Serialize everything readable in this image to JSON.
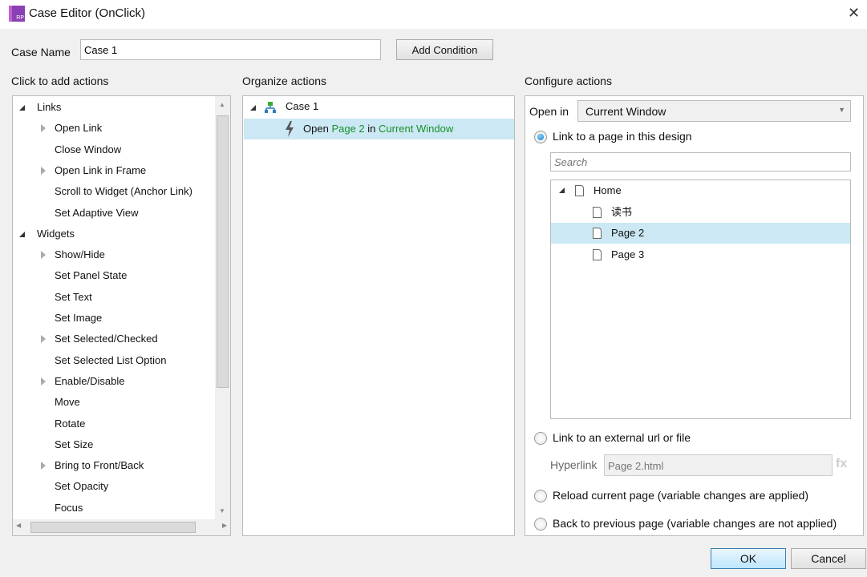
{
  "window": {
    "title": "Case Editor (OnClick)",
    "logo_text": "RP"
  },
  "case_name": {
    "label": "Case Name",
    "value": "Case 1"
  },
  "add_condition": "Add Condition",
  "left": {
    "heading": "Click to add actions",
    "items": [
      {
        "label": "Links",
        "group": true
      },
      {
        "label": "Open Link",
        "expandable": true
      },
      {
        "label": "Close Window"
      },
      {
        "label": "Open Link in Frame",
        "expandable": true
      },
      {
        "label": "Scroll to Widget (Anchor Link)"
      },
      {
        "label": "Set Adaptive View"
      },
      {
        "label": "Widgets",
        "group": true
      },
      {
        "label": "Show/Hide",
        "expandable": true
      },
      {
        "label": "Set Panel State"
      },
      {
        "label": "Set Text"
      },
      {
        "label": "Set Image"
      },
      {
        "label": "Set Selected/Checked",
        "expandable": true
      },
      {
        "label": "Set Selected List Option"
      },
      {
        "label": "Enable/Disable",
        "expandable": true
      },
      {
        "label": "Move"
      },
      {
        "label": "Rotate"
      },
      {
        "label": "Set Size"
      },
      {
        "label": "Bring to Front/Back",
        "expandable": true
      },
      {
        "label": "Set Opacity"
      },
      {
        "label": "Focus"
      }
    ]
  },
  "middle": {
    "heading": "Organize actions",
    "case_label": "Case 1",
    "action": {
      "verb": "Open",
      "target": "Page 2",
      "in": "in",
      "window": "Current Window"
    }
  },
  "right": {
    "heading": "Configure actions",
    "open_in_label": "Open in",
    "open_in_value": "Current Window",
    "option_link_page": "Link to a page in this design",
    "search_placeholder": "Search",
    "pages": [
      {
        "label": "Home",
        "root": true
      },
      {
        "label": "读书"
      },
      {
        "label": "Page 2",
        "selected": true
      },
      {
        "label": "Page 3"
      }
    ],
    "option_external": "Link to an external url or file",
    "hyperlink_label": "Hyperlink",
    "hyperlink_value": "Page 2.html",
    "fx": "fx",
    "option_reload": "Reload current page (variable changes are applied)",
    "option_back": "Back to previous page (variable changes are not applied)"
  },
  "buttons": {
    "ok": "OK",
    "cancel": "Cancel"
  },
  "colors": {
    "accent_green": "#1a8f2a",
    "selection": "#cce8f4"
  }
}
